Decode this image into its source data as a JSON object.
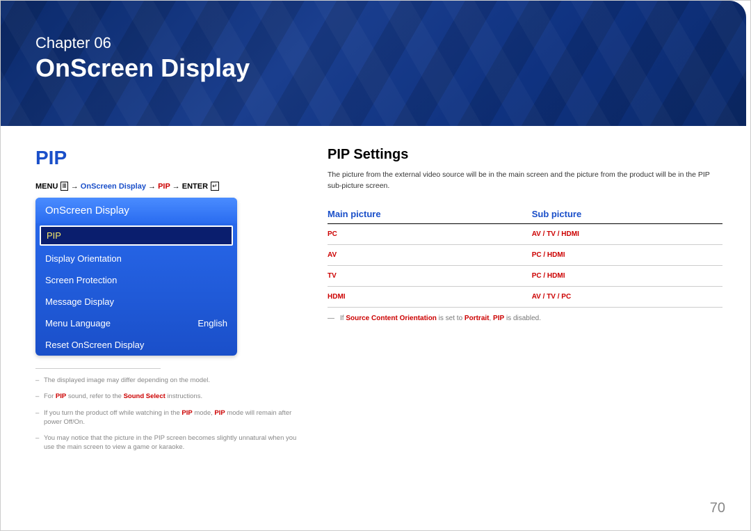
{
  "banner": {
    "chapter_label": "Chapter  06",
    "chapter_title": "OnScreen Display"
  },
  "left": {
    "heading": "PIP",
    "breadcrumb": {
      "menu": "MENU",
      "arrow": "→",
      "seg1": "OnScreen Display",
      "seg2": "PIP",
      "enter": "ENTER"
    },
    "menu": {
      "title": "OnScreen Display",
      "items": [
        {
          "label": "PIP",
          "value": "",
          "selected": true
        },
        {
          "label": "Display Orientation",
          "value": ""
        },
        {
          "label": "Screen Protection",
          "value": ""
        },
        {
          "label": "Message Display",
          "value": ""
        },
        {
          "label": "Menu Language",
          "value": "English"
        },
        {
          "label": "Reset OnScreen Display",
          "value": ""
        }
      ]
    },
    "footnotes": [
      "The displayed image may differ depending on the model.",
      "For <b>PIP</b> sound, refer to the <b>Sound Select</b> instructions.",
      "If you turn the product off while watching in the <b>PIP</b> mode, <b>PIP</b> mode will remain after power Off/On.",
      "You may notice that the picture in the PIP screen becomes slightly unnatural when you use the main screen to view a game or karaoke."
    ]
  },
  "right": {
    "heading": "PIP Settings",
    "description": "The picture from the external video source will be in the main screen and the picture from the product will be in the PIP sub-picture screen.",
    "table": {
      "headers": [
        "Main picture",
        "Sub picture"
      ],
      "rows": [
        [
          "PC",
          "AV / TV / HDMI"
        ],
        [
          "AV",
          "PC / HDMI"
        ],
        [
          "TV",
          "PC / HDMI"
        ],
        [
          "HDMI",
          "AV / TV / PC"
        ]
      ]
    },
    "note_parts": {
      "prefix": "If ",
      "bold1": "Source Content Orientation",
      "mid1": " is set to ",
      "bold2": "Portrait",
      "mid2": ", ",
      "bold3": "PIP",
      "suffix": " is disabled."
    }
  },
  "page_number": "70"
}
